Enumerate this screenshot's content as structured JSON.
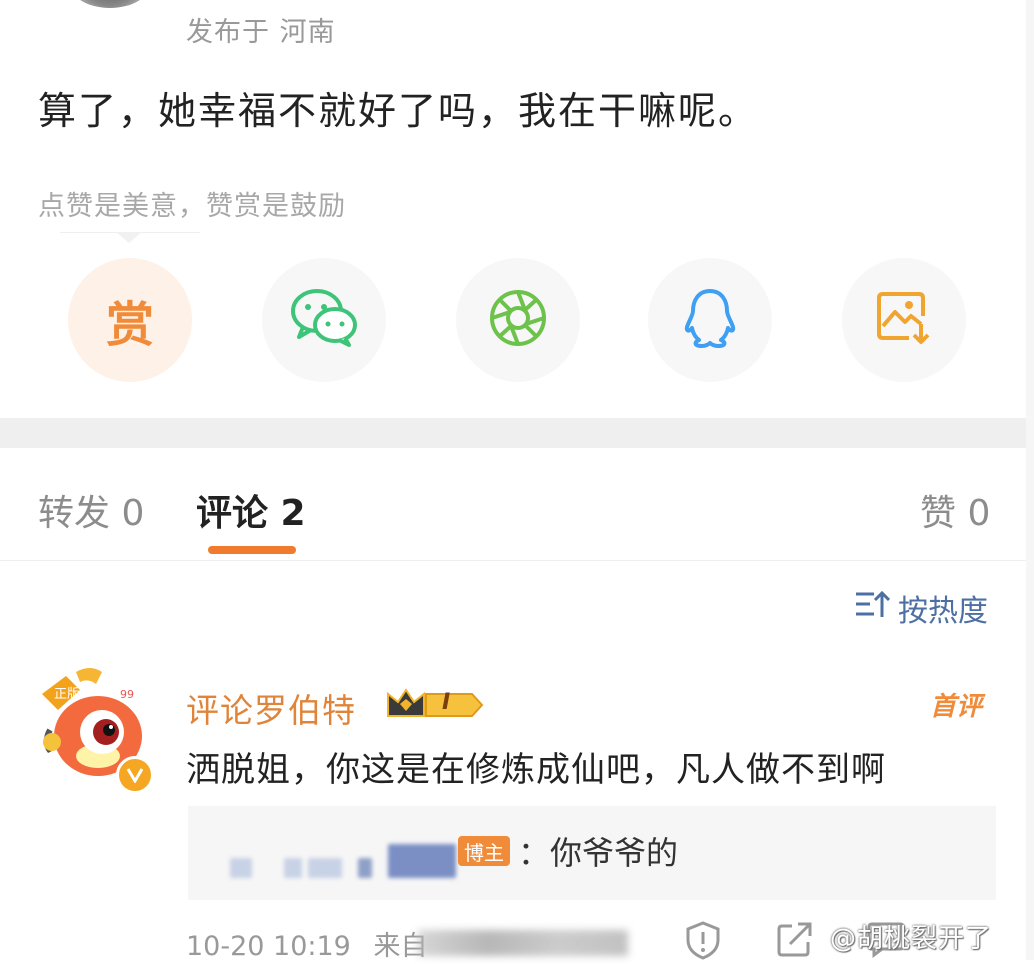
{
  "post": {
    "publish_location": "发布于 河南",
    "text": "算了，她幸福不就好了吗，我在干嘛呢。",
    "reward_tip": "点赞是美意，赞赏是鼓励"
  },
  "share": {
    "reward_label": "赏",
    "icons": [
      "wechat-icon",
      "moments-icon",
      "qq-icon",
      "save-image-icon"
    ]
  },
  "tabs": {
    "repost": "转发 0",
    "comment": "评论 2",
    "like": "赞 0"
  },
  "sort": {
    "label": "按热度"
  },
  "comment": {
    "username": "评论罗伯特",
    "level_badge": "I",
    "first_badge": "首评",
    "text": "洒脱姐，你这是在修炼成仙吧，凡人做不到啊",
    "reply": {
      "author_badge": "博主",
      "text": "：你爷爷的"
    },
    "time": "10-20 10:19",
    "source_prefix": "来自"
  },
  "watermark": "@胡桃裂开了",
  "colors": {
    "accent": "#f07a2e",
    "link": "#4d6fa3",
    "username": "#e0843a"
  }
}
